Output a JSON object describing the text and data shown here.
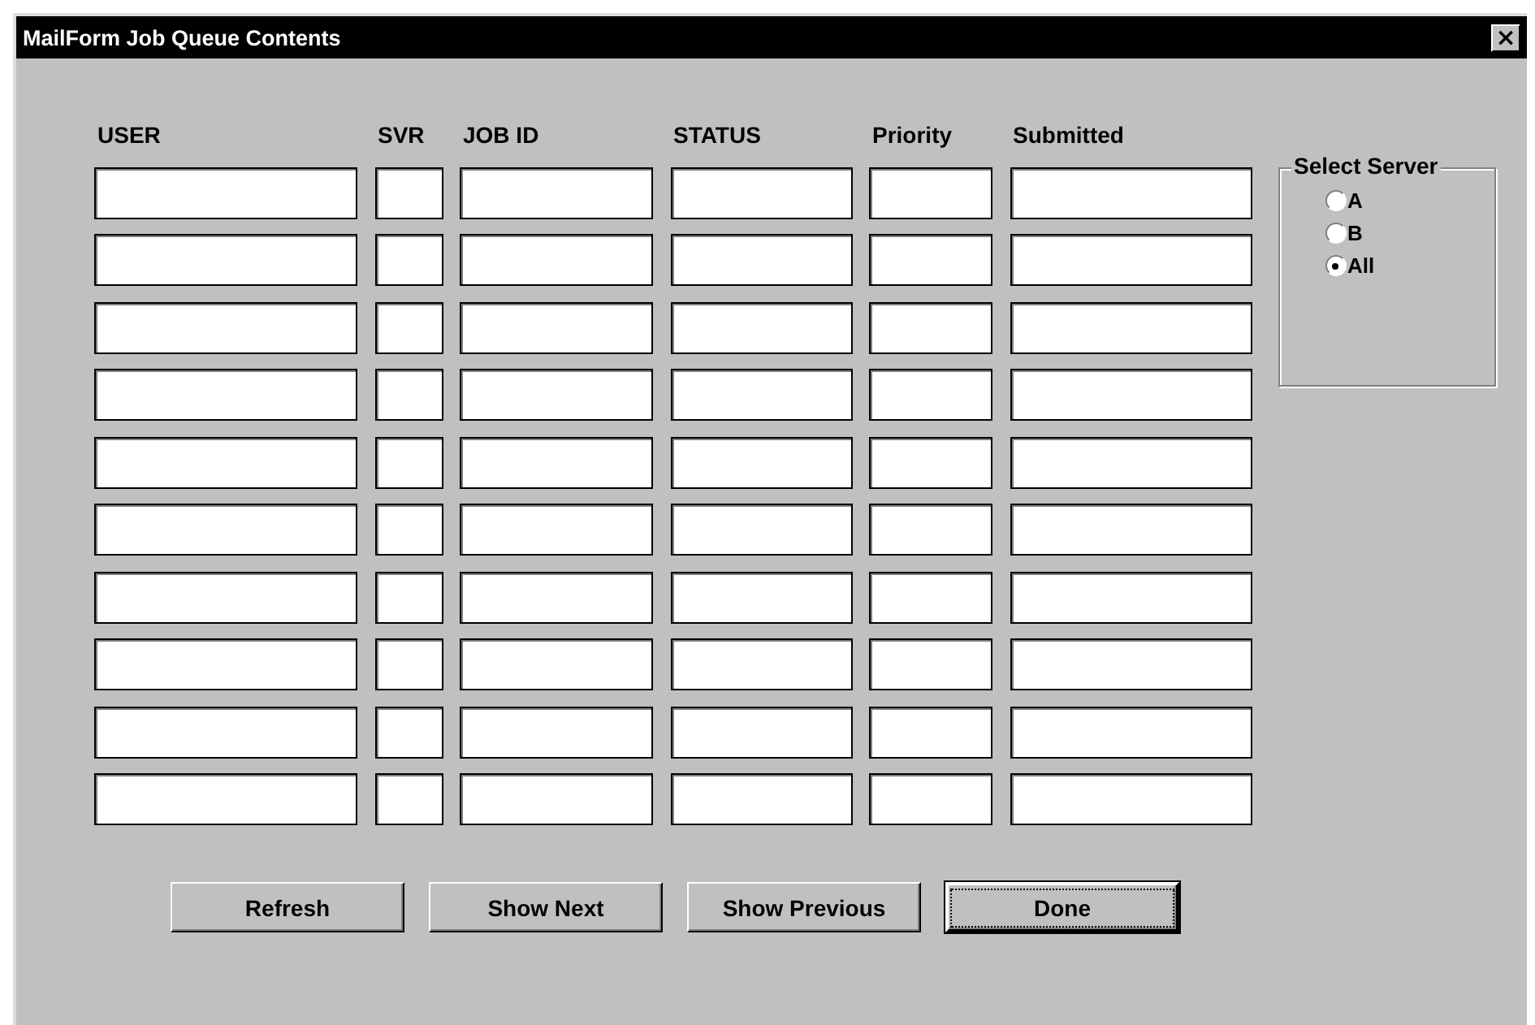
{
  "window": {
    "title": "MailForm Job Queue Contents",
    "close": "×"
  },
  "table": {
    "columns": [
      "USER",
      "SVR",
      "JOB ID",
      "STATUS",
      "Priority",
      "Submitted"
    ],
    "rows": [
      {
        "kind": "empty"
      },
      {
        "kind": "empty"
      },
      {
        "kind": "empty"
      },
      {
        "kind": "empty"
      },
      {
        "kind": "empty"
      },
      {
        "kind": "empty"
      },
      {
        "kind": "empty"
      },
      {
        "kind": "empty"
      },
      {
        "kind": "empty"
      },
      {
        "kind": "empty"
      }
    ]
  },
  "server_group": {
    "title": "Select Server",
    "options": [
      {
        "label": "A",
        "selected": false
      },
      {
        "label": "B",
        "selected": false
      },
      {
        "label": "All",
        "selected": true
      }
    ]
  },
  "buttons": [
    {
      "label": "Refresh",
      "default": false
    },
    {
      "label": "Show Next",
      "default": false
    },
    {
      "label": "Show Previous",
      "default": false
    },
    {
      "label": "Done",
      "default": true
    }
  ]
}
